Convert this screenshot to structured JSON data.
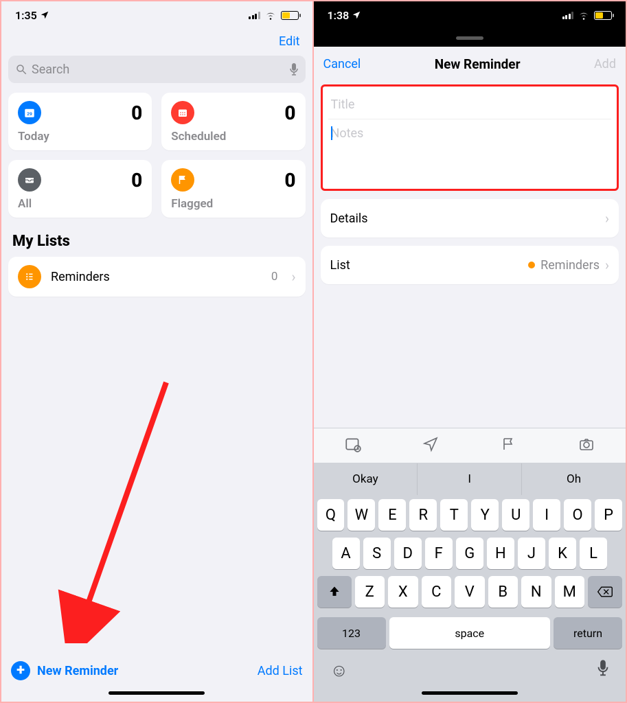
{
  "left": {
    "status": {
      "time": "1:35"
    },
    "nav": {
      "edit": "Edit"
    },
    "search": {
      "placeholder": "Search"
    },
    "cards": {
      "today": {
        "label": "Today",
        "count": "0"
      },
      "scheduled": {
        "label": "Scheduled",
        "count": "0"
      },
      "all": {
        "label": "All",
        "count": "0"
      },
      "flagged": {
        "label": "Flagged",
        "count": "0"
      }
    },
    "section_title": "My Lists",
    "list": {
      "name": "Reminders",
      "count": "0"
    },
    "bottom": {
      "new_reminder": "New Reminder",
      "add_list": "Add List"
    }
  },
  "right": {
    "status": {
      "time": "1:38"
    },
    "nav": {
      "cancel": "Cancel",
      "title": "New Reminder",
      "add": "Add"
    },
    "inputs": {
      "title_placeholder": "Title",
      "notes_placeholder": "Notes"
    },
    "rows": {
      "details": "Details",
      "list_label": "List",
      "list_value": "Reminders"
    },
    "suggestions": [
      "Okay",
      "I",
      "Oh"
    ],
    "keyboard": {
      "row1": [
        "Q",
        "W",
        "E",
        "R",
        "T",
        "Y",
        "U",
        "I",
        "O",
        "P"
      ],
      "row2": [
        "A",
        "S",
        "D",
        "F",
        "G",
        "H",
        "J",
        "K",
        "L"
      ],
      "row3": [
        "Z",
        "X",
        "C",
        "V",
        "B",
        "N",
        "M"
      ],
      "num": "123",
      "space": "space",
      "ret": "return"
    }
  }
}
